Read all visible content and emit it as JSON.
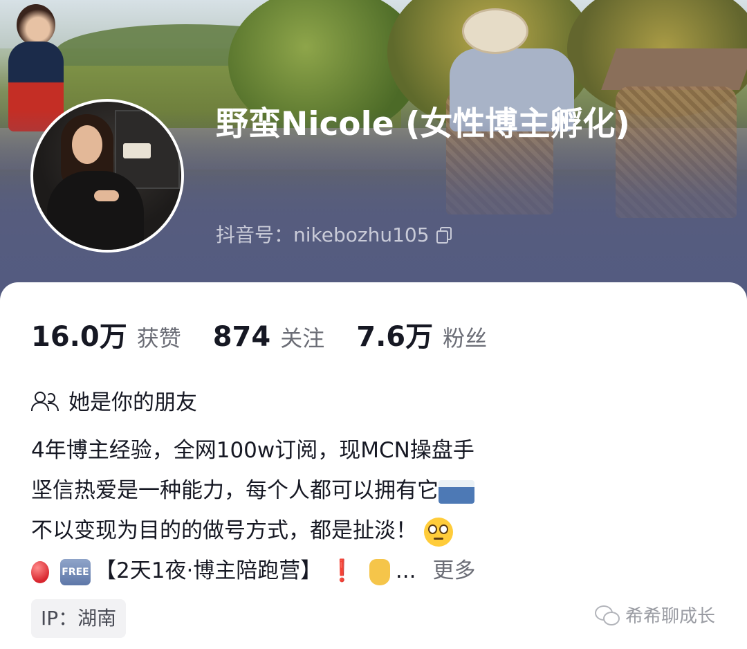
{
  "profile": {
    "name": "野蛮Nicole (女性博主孵化)",
    "douyin_id": "抖音号：nikebozhu105"
  },
  "stats": [
    {
      "value": "16.0万",
      "label": "获赞"
    },
    {
      "value": "874",
      "label": "关注"
    },
    {
      "value": "7.6万",
      "label": "粉丝"
    }
  ],
  "relation": "她是你的朋友",
  "bio": {
    "line1": "4年博主经验，全网100w订阅，现MCN操盘手",
    "line2": "坚信热爱是一种能力，每个人都可以拥有它",
    "line3": "不以变现为目的的做号方式，都是扯淡！",
    "line4_badge": "FREE",
    "line4_text": "【2天1夜·博主陪跑营】",
    "line4_excl": "❗",
    "line4_ellipsis": "...",
    "more": "更多"
  },
  "ip": "IP：湖南",
  "watermark": "希希聊成长",
  "icons": {
    "copy": "copy-icon",
    "friends": "friends-icon",
    "balloon": "balloon-emoji",
    "free": "free-button-emoji",
    "wave": "wave-emoji",
    "eye_roll": "eye-roll-emoji",
    "point_down": "pointing-down-emoji",
    "wechat": "wechat-icon"
  }
}
